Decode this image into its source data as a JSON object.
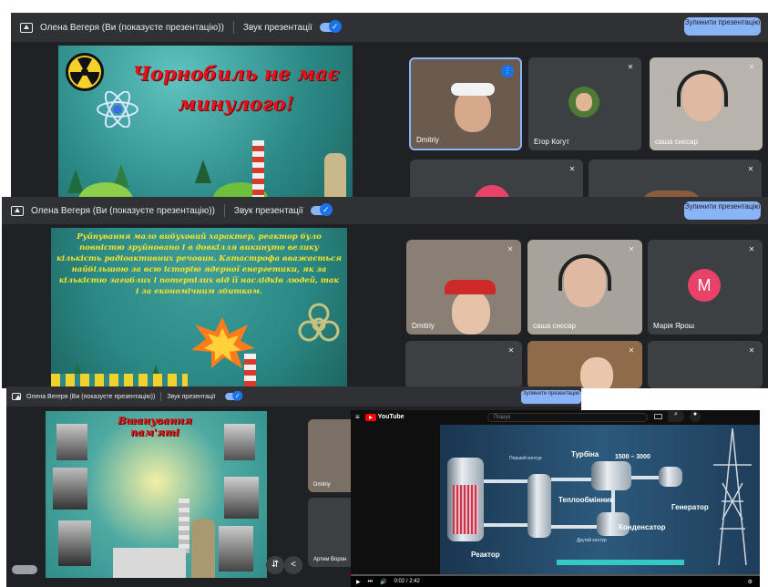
{
  "meet1": {
    "presenter": "Олена Вегеря (Ви (показуєте презентацію))",
    "sound_label": "Звук презентації",
    "stop_button": "Зупинити презентацію",
    "slide_title": "Чорнобиль не має минулого!",
    "participants": [
      {
        "name": "Dmitriy"
      },
      {
        "name": "Егор Когут"
      },
      {
        "name": "саша снєсар"
      }
    ]
  },
  "meet2": {
    "presenter": "Олена Вегеря (Ви (показуєте презентацію))",
    "sound_label": "Звук презентації",
    "stop_button": "Зупинити презентацію",
    "slide_text": "Руйнування мало вибуховий характер, реактор було повністю зруйновано і в довкілля викинуто велику кількість радіоактивних речовин. Катастрофа вважається найбільшою за всю історію ядерної енергетики, як за кількістю загиблих і потерпілих від її наслідків людей, так і за економічним збитком.",
    "participants": [
      {
        "name": "Dmitriy"
      },
      {
        "name": "саша снєсар"
      },
      {
        "name": "Марія Ярош",
        "initial": "М"
      }
    ]
  },
  "meet3": {
    "presenter": "Олена Вегеря (Ви (показуєте презентацію))",
    "sound_label": "Звук презентації",
    "stop_button": "Зупинити презентацію",
    "slide_title": "Вшанування пам'яті",
    "participants": [
      {
        "name": "Dmitriy"
      },
      {
        "name": "Артем Ворон"
      }
    ]
  },
  "youtube": {
    "logo": "YouTube",
    "search_placeholder": "Пошук",
    "time": "0:02 / 2:42",
    "labels": {
      "turbine": "Турбіна",
      "turbine_speed": "1500 – 3000",
      "first_loop": "Перший контур",
      "heat_exchanger": "Теплообмінник",
      "generator": "Генератор",
      "condenser": "Конденсатор",
      "reactor": "Реактор",
      "second_loop": "Другий контур"
    }
  },
  "colors": {
    "meet_bg": "#202124",
    "meet_bar": "#303134",
    "accent": "#8ab4f8",
    "slide_teal": "#2b8a86",
    "slide_red": "#e3121d",
    "slide_yellow": "#f7e52b"
  }
}
